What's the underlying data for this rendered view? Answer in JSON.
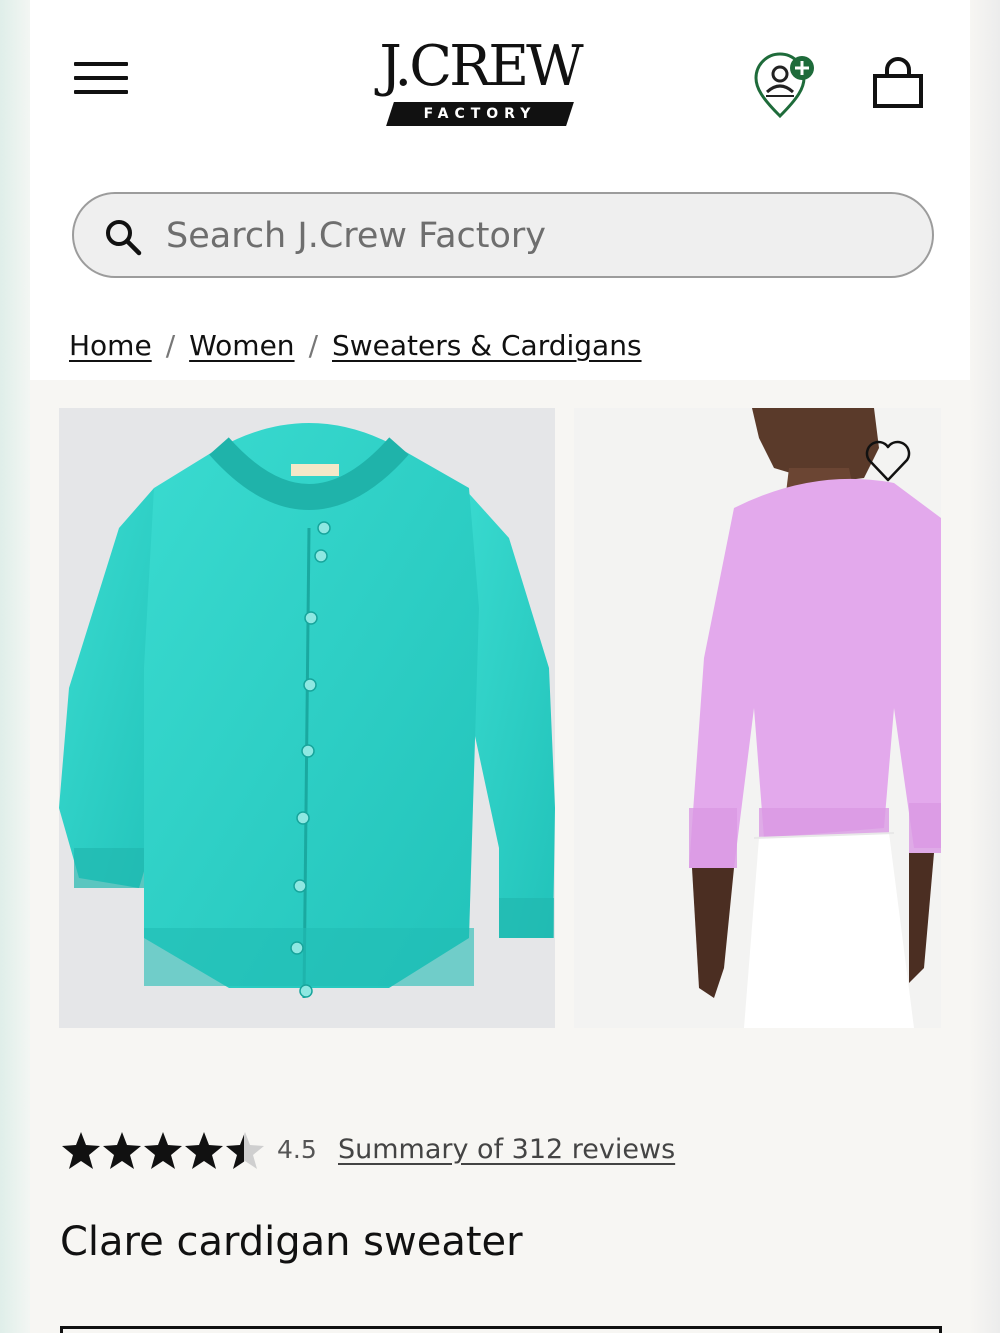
{
  "header": {
    "logo_main": "J.CREW",
    "logo_sub": "FACTORY"
  },
  "search": {
    "placeholder": "Search J.Crew Factory"
  },
  "breadcrumb": {
    "items": [
      "Home",
      "Women",
      "Sweaters & Cardigans"
    ],
    "separator": "/"
  },
  "gallery": {
    "main_image_color": "#2fd3c9",
    "alt_image_color": "#e3a9ec"
  },
  "rating": {
    "stars": 4.5,
    "value": "4.5",
    "reviews_link": "Summary of 312 reviews"
  },
  "product": {
    "title": "Clare cardigan sweater"
  },
  "colors": {
    "accent_green": "#1e6b3a",
    "text": "#111111"
  }
}
